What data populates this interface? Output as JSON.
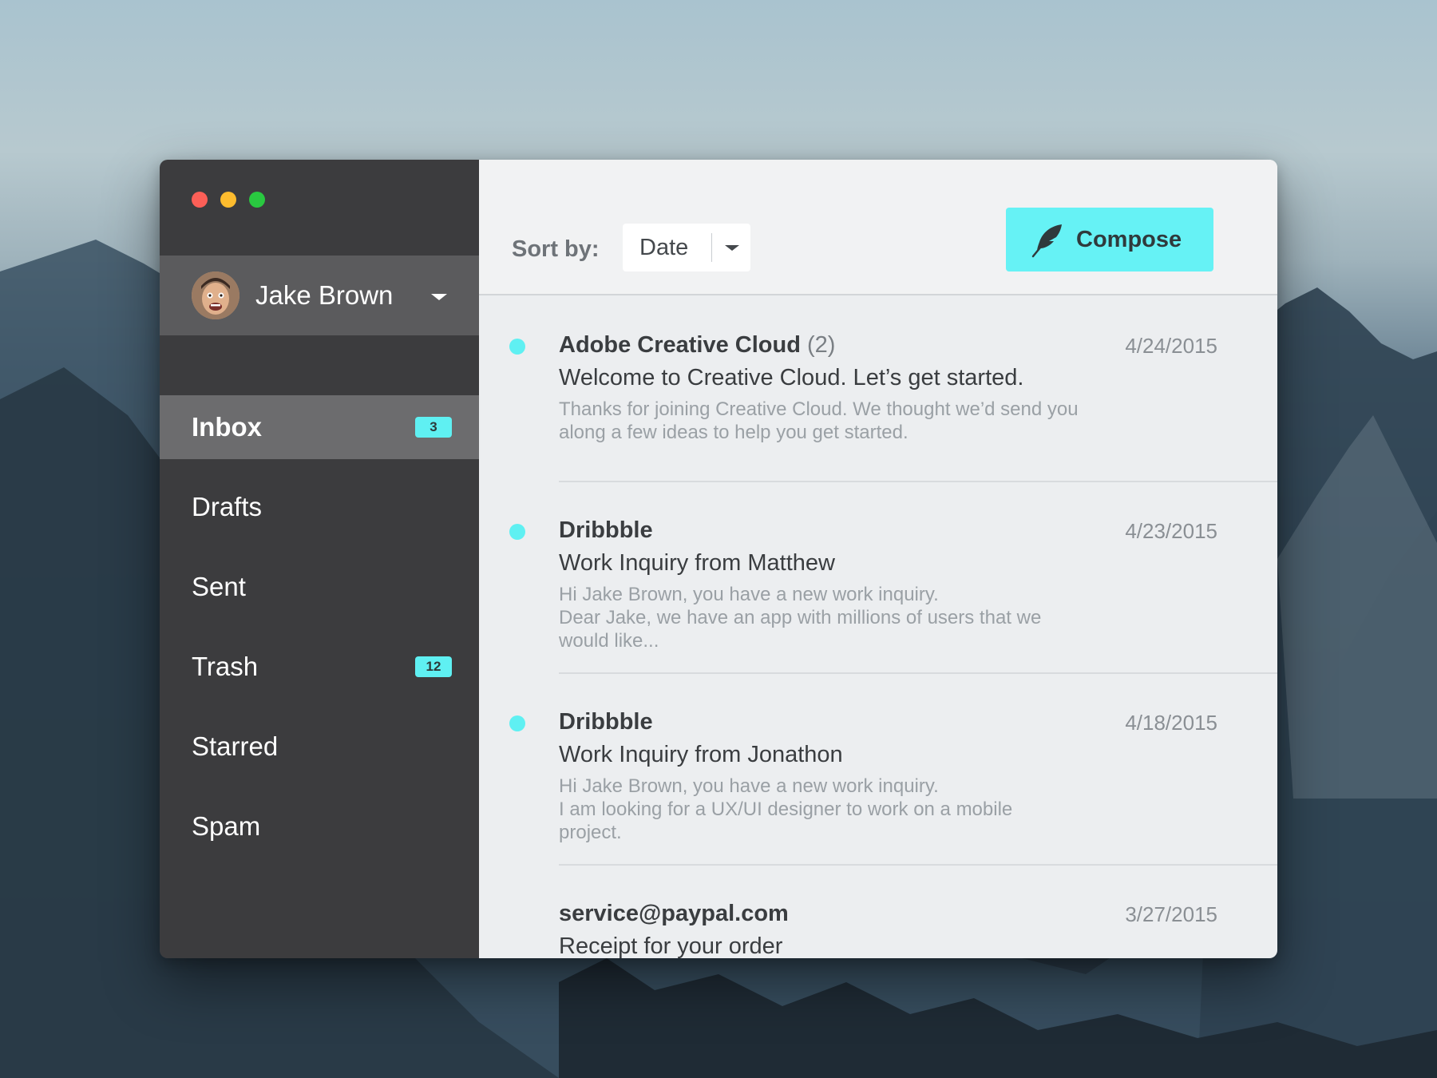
{
  "sidebar": {
    "user": {
      "name": "Jake Brown"
    },
    "nav": [
      {
        "label": "Inbox",
        "badge": "3",
        "active": true
      },
      {
        "label": "Drafts",
        "badge": ""
      },
      {
        "label": "Sent",
        "badge": ""
      },
      {
        "label": "Trash",
        "badge": "12"
      },
      {
        "label": "Starred",
        "badge": ""
      },
      {
        "label": "Spam",
        "badge": ""
      }
    ]
  },
  "toolbar": {
    "sort_label": "Sort by:",
    "sort_value": "Date",
    "compose_label": "Compose",
    "compose_icon": "feather-icon"
  },
  "messages": [
    {
      "sender": "Adobe Creative Cloud",
      "count": "(2)",
      "date": "4/24/2015",
      "subject": "Welcome to Creative Cloud. Let’s get started.",
      "preview": [
        "Thanks for joining Creative Cloud. We thought we’d send you",
        "along a few ideas to help you get started."
      ],
      "unread": true
    },
    {
      "sender": "Dribbble",
      "count": "",
      "date": "4/23/2015",
      "subject": "Work Inquiry from Matthew",
      "preview": [
        "Hi Jake Brown, you have a new work inquiry.",
        "Dear Jake, we have an app with millions of users that we",
        "would like..."
      ],
      "unread": true
    },
    {
      "sender": "Dribbble",
      "count": "",
      "date": "4/18/2015",
      "subject": "Work Inquiry from Jonathon",
      "preview": [
        "Hi Jake Brown, you have a new work inquiry.",
        "I am looking for a UX/UI designer to work on a mobile",
        "project."
      ],
      "unread": true
    },
    {
      "sender": "service@paypal.com",
      "count": "",
      "date": "3/27/2015",
      "subject": "Receipt for your order",
      "preview": [],
      "unread": false
    }
  ],
  "colors": {
    "accent": "#66f2f5",
    "sidebar_bg": "#3c3c3e",
    "active_item_bg": "#6c6c6e"
  }
}
